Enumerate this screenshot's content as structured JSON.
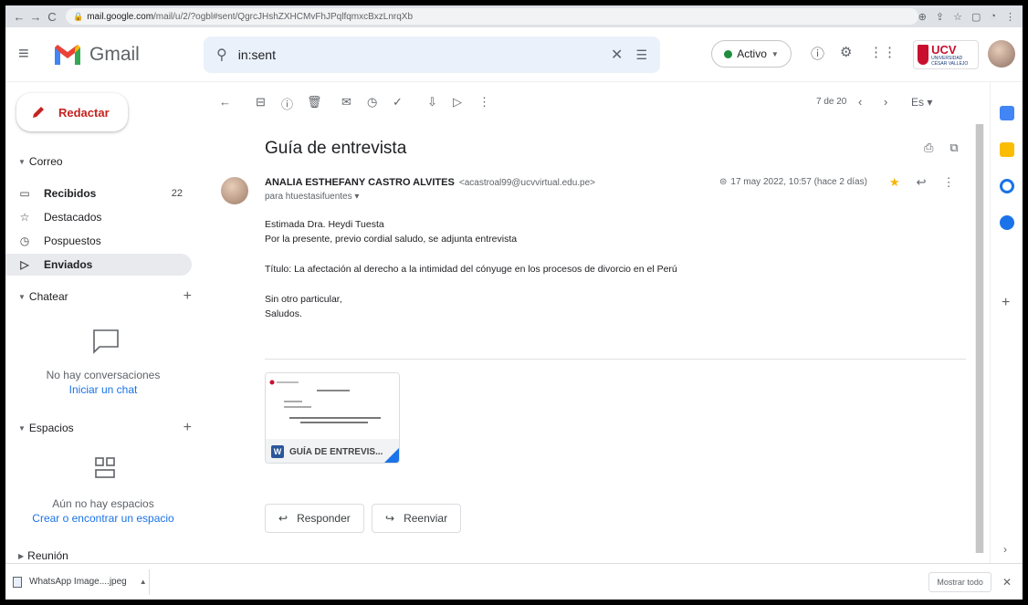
{
  "browser": {
    "url_host": "mail.google.com",
    "url_path": "/mail/u/2/?ogbl#sent/QgrcJHshZXHCMvFhJPqlfqmxcBxzLnrqXb"
  },
  "header": {
    "app_name": "Gmail",
    "search_value": "in:sent",
    "status_label": "Activo",
    "org_name": "UCV",
    "org_sub": "UNIVERSIDAD CÉSAR VALLEJO"
  },
  "sidebar": {
    "compose_label": "Redactar",
    "mail_section": "Correo",
    "items": [
      {
        "label": "Recibidos",
        "count": "22"
      },
      {
        "label": "Destacados",
        "count": ""
      },
      {
        "label": "Pospuestos",
        "count": ""
      },
      {
        "label": "Enviados",
        "count": ""
      }
    ],
    "chat_section": "Chatear",
    "chat_empty": "No hay conversaciones",
    "chat_link": "Iniciar un chat",
    "spaces_section": "Espacios",
    "spaces_empty": "Aún no hay espacios",
    "spaces_link": "Crear o encontrar un espacio",
    "meet_section": "Reunión"
  },
  "toolbar": {
    "pager": "7 de 20",
    "lang": "Es"
  },
  "email": {
    "subject": "Guía de entrevista",
    "sender_name": "ANALIA ESTHEFANY CASTRO ALVITES",
    "sender_email": "<acastroal99@ucvvirtual.edu.pe>",
    "to": "para htuestasifuentes",
    "date": "17 may 2022, 10:57 (hace 2 días)",
    "body": [
      "Estimada Dra. Heydi Tuesta",
      "Por la presente, previo cordial saludo, se adjunta entrevista",
      "Título: La afectación al derecho a la intimidad del cónyuge en los procesos de divorcio en el Perú",
      "Sin otro particular,",
      "Saludos."
    ],
    "attachment_name": "GUÍA DE ENTREVIS...",
    "reply_label": "Responder",
    "forward_label": "Reenviar"
  },
  "downloads": {
    "file_name": "WhatsApp Image....jpeg",
    "show_all": "Mostrar todo"
  },
  "icons": {
    "gmail_red": "#ea4335",
    "ucv_red": "#c8102e"
  }
}
